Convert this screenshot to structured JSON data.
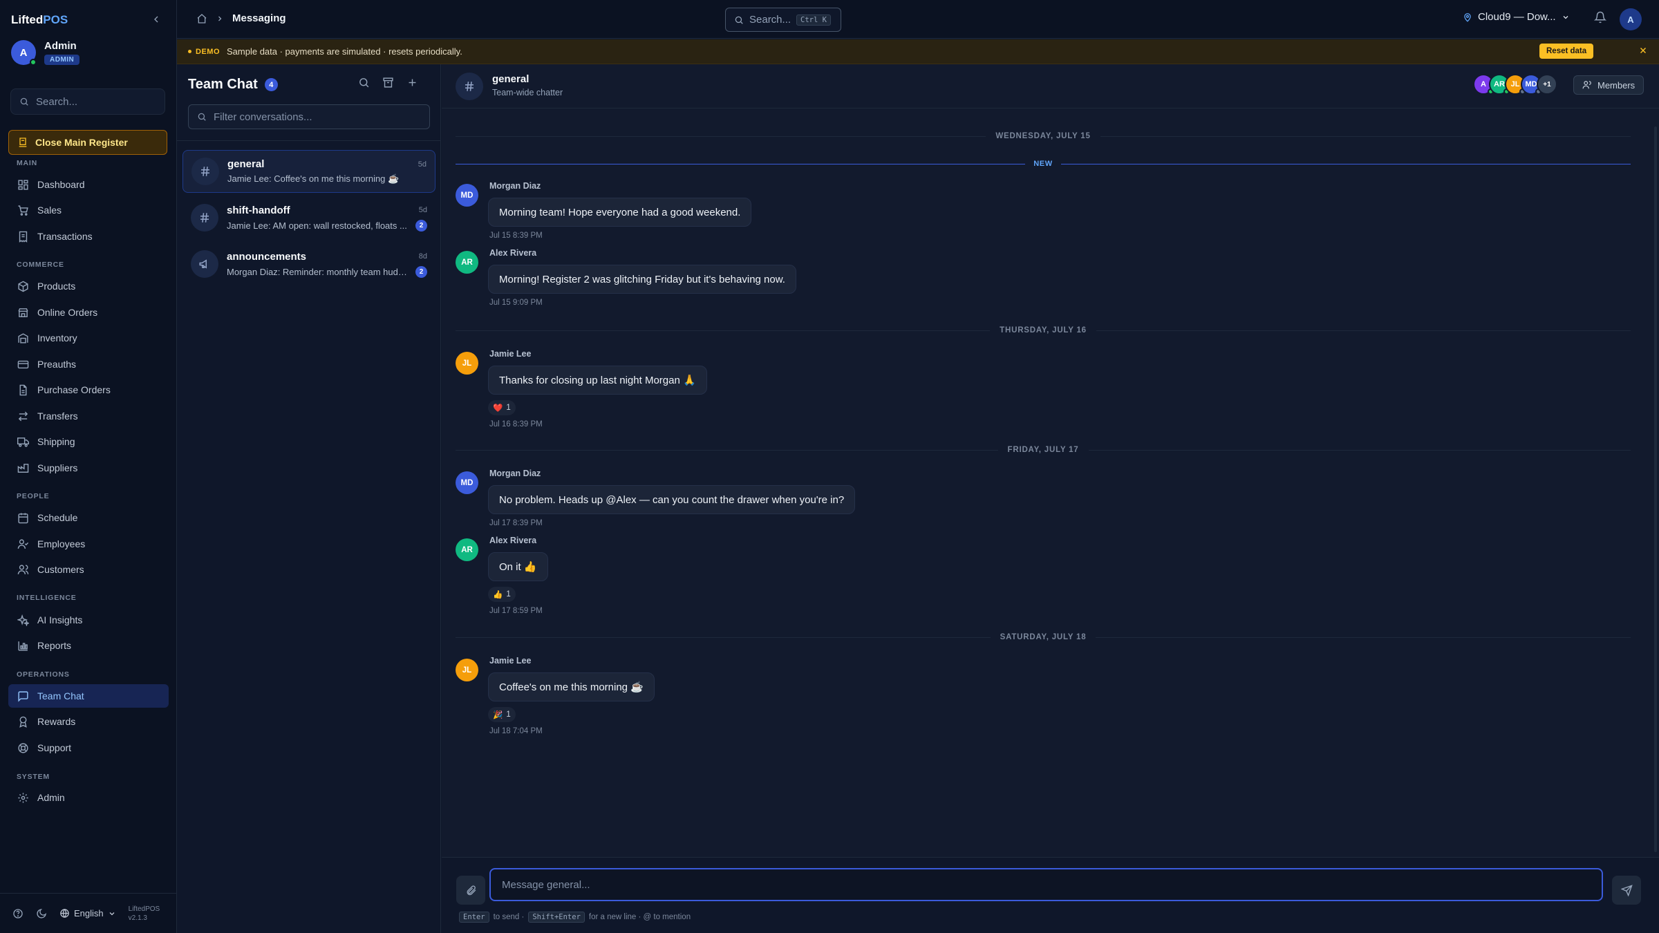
{
  "sidebar": {
    "brand_main": "Lifted",
    "brand_accent": "POS",
    "user": {
      "initial": "A",
      "name": "Admin",
      "role": "ADMIN"
    },
    "search_placeholder": "Search...",
    "register_button": "Close Main Register",
    "sections": {
      "main": "MAIN",
      "commerce": "COMMERCE",
      "people": "PEOPLE",
      "intelligence": "INTELLIGENCE",
      "operations": "OPERATIONS",
      "system": "SYSTEM"
    },
    "items": {
      "dashboard": "Dashboard",
      "sales": "Sales",
      "transactions": "Transactions",
      "products": "Products",
      "online_orders": "Online Orders",
      "inventory": "Inventory",
      "preauths": "Preauths",
      "purchase_orders": "Purchase Orders",
      "transfers": "Transfers",
      "shipping": "Shipping",
      "suppliers": "Suppliers",
      "schedule": "Schedule",
      "employees": "Employees",
      "customers": "Customers",
      "ai_insights": "AI Insights",
      "reports": "Reports",
      "team_chat": "Team Chat",
      "rewards": "Rewards",
      "support": "Support",
      "admin": "Admin"
    },
    "active_item": "team_chat",
    "footer": {
      "language": "English",
      "app_name": "LiftedPOS",
      "version": "v2.1.3"
    }
  },
  "topbar": {
    "breadcrumb_current": "Messaging",
    "search_placeholder": "Search...",
    "search_shortcut": "Ctrl K",
    "location": "Cloud9 — Dow...",
    "user_initial": "A"
  },
  "banner": {
    "tag": "DEMO",
    "text": "Sample data · payments are simulated · resets periodically.",
    "reset_label": "Reset data"
  },
  "conversations": {
    "title": "Team Chat",
    "count": "4",
    "filter_placeholder": "Filter conversations...",
    "items": [
      {
        "name": "general",
        "time": "5d",
        "preview": "Jamie Lee: Coffee's on me this morning ☕",
        "unread": "",
        "icon": "hash-icon"
      },
      {
        "name": "shift-handoff",
        "time": "5d",
        "preview": "Jamie Lee: AM open: wall restocked, floats ...",
        "unread": "2",
        "icon": "hash-icon"
      },
      {
        "name": "announcements",
        "time": "8d",
        "preview": "Morgan Diaz: Reminder: monthly team huddl...",
        "unread": "2",
        "icon": "megaphone-icon"
      }
    ]
  },
  "chat": {
    "channel_name": "general",
    "channel_desc": "Team-wide chatter",
    "members_label": "Members",
    "member_avatars": [
      {
        "initials": "A",
        "color": "#7c3aed",
        "presence": "#22c55e"
      },
      {
        "initials": "AR",
        "color": "#10b981",
        "presence": "#22c55e"
      },
      {
        "initials": "JL",
        "color": "#f59e0b",
        "presence": "#64748b"
      },
      {
        "initials": "MD",
        "color": "#3b5bdb",
        "presence": "#64748b"
      },
      {
        "initials": "+1",
        "color": "#334155",
        "presence": ""
      }
    ],
    "new_label": "NEW",
    "days": [
      "WEDNESDAY, JULY 15",
      "THURSDAY, JULY 16",
      "FRIDAY, JULY 17",
      "SATURDAY, JULY 18"
    ],
    "messages": [
      {
        "initials": "MD",
        "color": "#3b5bdb",
        "author": "Morgan Diaz",
        "text": "Morning team! Hope everyone had a good weekend.",
        "reaction_emoji": "",
        "reaction_count": "",
        "time": "Jul 15 8:39 PM"
      },
      {
        "initials": "AR",
        "color": "#10b981",
        "author": "Alex Rivera",
        "text": "Morning! Register 2 was glitching Friday but it's behaving now.",
        "reaction_emoji": "",
        "reaction_count": "",
        "time": "Jul 15 9:09 PM"
      },
      {
        "initials": "JL",
        "color": "#f59e0b",
        "author": "Jamie Lee",
        "text": "Thanks for closing up last night Morgan 🙏",
        "reaction_emoji": "❤️",
        "reaction_count": "1",
        "time": "Jul 16 8:39 PM"
      },
      {
        "initials": "MD",
        "color": "#3b5bdb",
        "author": "Morgan Diaz",
        "text": "No problem. Heads up @Alex — can you count the drawer when you're in?",
        "reaction_emoji": "",
        "reaction_count": "",
        "time": "Jul 17 8:39 PM"
      },
      {
        "initials": "AR",
        "color": "#10b981",
        "author": "Alex Rivera",
        "text": "On it 👍",
        "reaction_emoji": "👍",
        "reaction_count": "1",
        "time": "Jul 17 8:59 PM"
      },
      {
        "initials": "JL",
        "color": "#f59e0b",
        "author": "Jamie Lee",
        "text": "Coffee's on me this morning ☕",
        "reaction_emoji": "🎉",
        "reaction_count": "1",
        "time": "Jul 18 7:04 PM"
      }
    ],
    "composer": {
      "placeholder": "Message general...",
      "hint_key1": "Enter",
      "hint_text1": "to send ·",
      "hint_key2": "Shift+Enter",
      "hint_text2": "for a new line · @ to mention"
    }
  },
  "colors": {
    "accent": "#3b5bdb",
    "warning": "#fbbf24",
    "background": "#0f172a"
  }
}
